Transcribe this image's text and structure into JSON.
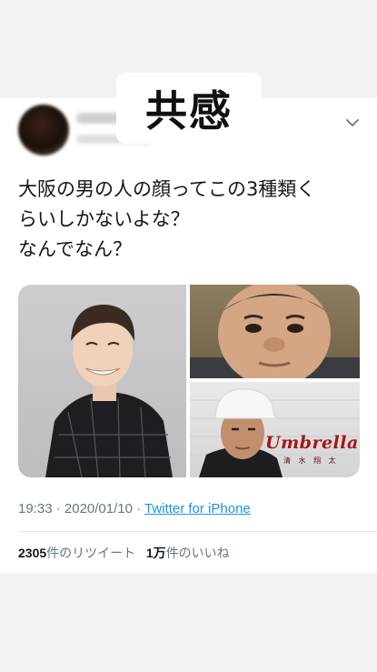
{
  "caption": "共感",
  "tweet": {
    "text_lines": [
      "大阪の男の人の顔ってこの3種類く",
      "らいしかないよな？",
      "なんでなん？"
    ],
    "time": "19:33",
    "separator": "·",
    "date": "2020/01/10",
    "source": "Twitter for iPhone"
  },
  "stats": {
    "retweets_count": "2305",
    "retweets_label": "件のリツイート",
    "likes_count": "1万",
    "likes_label": "件のいいね"
  },
  "media": {
    "logo_text": "Umbrella",
    "logo_subtext": "清 水 翔 太"
  },
  "icons": {
    "chevron": "chevron-down-icon"
  },
  "colors": {
    "link": "#1b95e0",
    "meta": "#657786",
    "text": "#14171a",
    "background": "#f2f2f4"
  }
}
